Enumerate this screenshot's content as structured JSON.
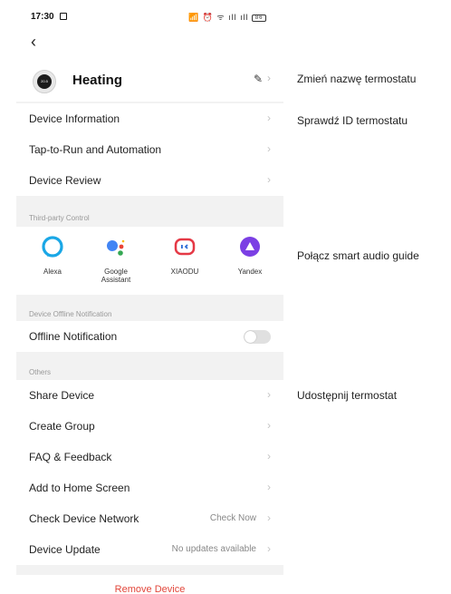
{
  "status": {
    "time": "17:30",
    "icons": "📶 ⏰ ᯤ ıll ıll",
    "battery": "86"
  },
  "device": {
    "name": "Heating",
    "thumb": "20.5"
  },
  "menu_top": [
    {
      "label": "Device Information"
    },
    {
      "label": "Tap-to-Run and Automation"
    },
    {
      "label": "Device Review"
    }
  ],
  "third_party": {
    "section": "Third-party Control",
    "items": [
      {
        "label": "Alexa",
        "icon": "alexa-icon",
        "color": "#1aa7e6"
      },
      {
        "label": "Google\nAssistant",
        "icon": "google-assistant-icon",
        "color": "#4285f4"
      },
      {
        "label": "XIAODU",
        "icon": "xiaodu-icon",
        "color": "#e53946"
      },
      {
        "label": "Yandex",
        "icon": "yandex-alice-icon",
        "color": "#7b3fe4"
      }
    ]
  },
  "offline": {
    "section": "Device Offline Notification",
    "label": "Offline Notification",
    "enabled": false
  },
  "others": {
    "section": "Others",
    "items": [
      {
        "label": "Share Device",
        "value": ""
      },
      {
        "label": "Create Group",
        "value": ""
      },
      {
        "label": "FAQ & Feedback",
        "value": ""
      },
      {
        "label": "Add to Home Screen",
        "value": ""
      },
      {
        "label": "Check Device Network",
        "value": "Check Now"
      },
      {
        "label": "Device Update",
        "value": "No updates available"
      }
    ]
  },
  "remove": "Remove Device",
  "annotations": {
    "rename": "Zmień nazwę termostatu",
    "check_id": "Sprawdź ID termostatu",
    "connect_audio": "Połącz smart audio guide",
    "share": "Udostępnij termostat"
  },
  "colors": {
    "danger": "#e2463a",
    "chevron": "#c4c4c4"
  }
}
